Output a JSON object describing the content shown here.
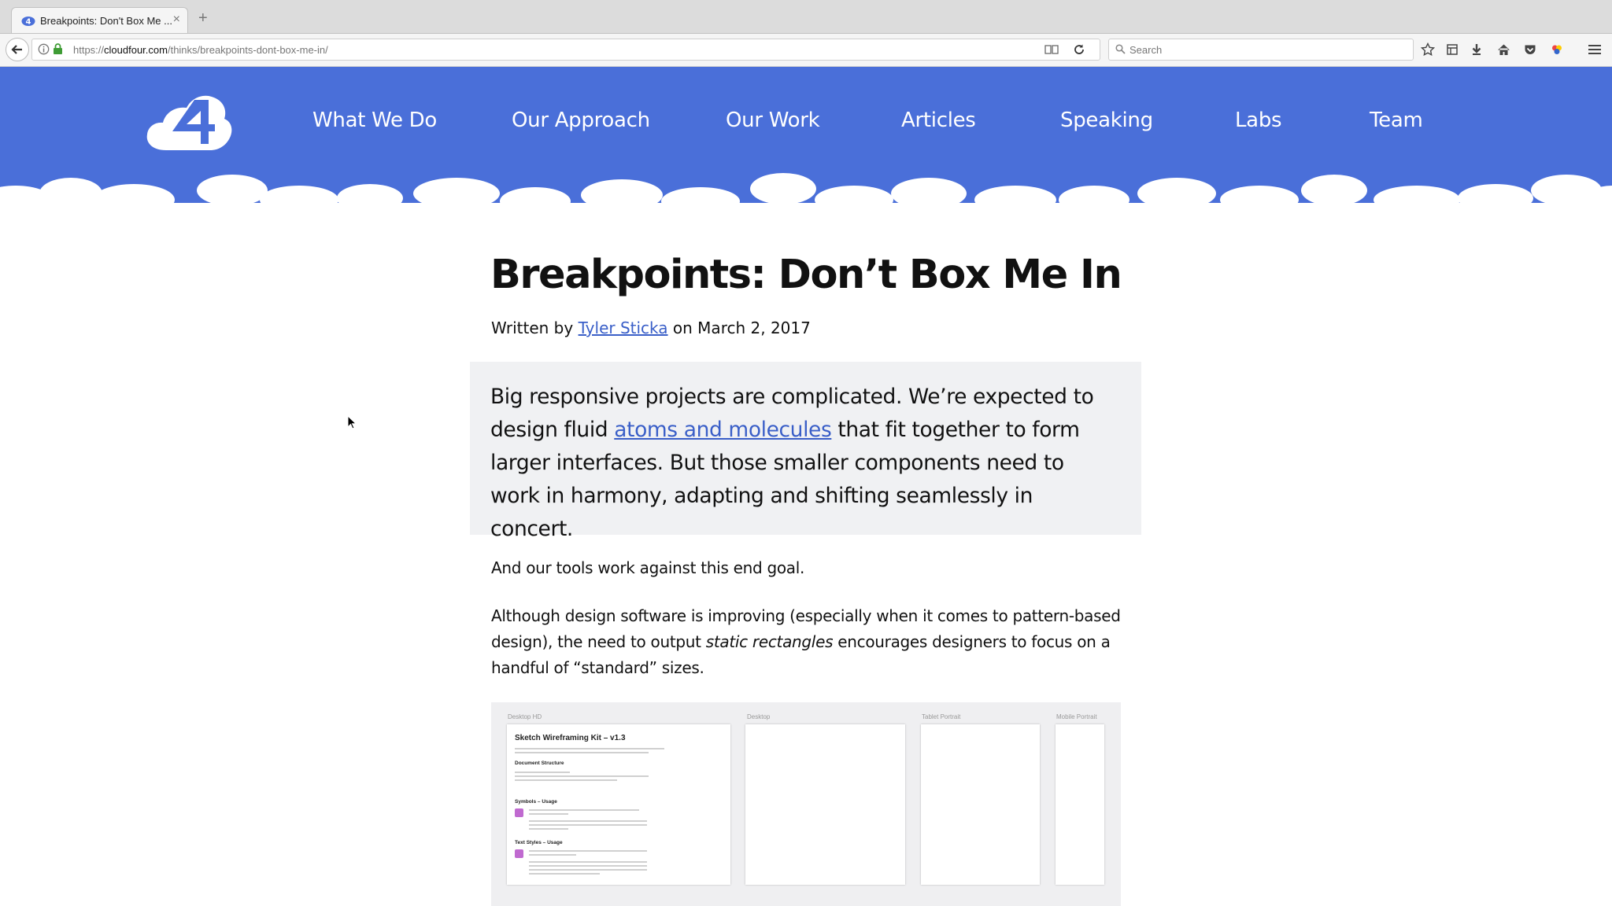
{
  "browser": {
    "tab_title": "Breakpoints: Don't Box Me ...",
    "url_prefix": "https://",
    "url_host": "cloudfour.com",
    "url_path": "/thinks/breakpoints-dont-box-me-in/",
    "search_placeholder": "Search"
  },
  "site": {
    "brand_color": "#4a6fd9",
    "nav": [
      "What We Do",
      "Our Approach",
      "Our Work",
      "Articles",
      "Speaking",
      "Labs",
      "Team"
    ]
  },
  "article": {
    "title": "Breakpoints: Don’t Box Me In",
    "byline_prefix": "Written by",
    "author": "Tyler Sticka",
    "byline_suffix": "on March 2, 2017",
    "intro_before_link": "Big responsive projects are complicated. We’re expected to design fluid",
    "intro_link": "atoms and molecules",
    "intro_after_link": "that fit together to form larger interfaces. But those smaller components need to work in harmony, adapting and shifting seamlessly in concert.",
    "para1": "And our tools work against this end goal.",
    "para2_before": "Although design software is improving (especially when it comes to pattern-based design), the need to output",
    "para2_em": "static rectangles",
    "para2_after": "encourages designers to focus on a handful of “standard” sizes."
  },
  "sketch_image": {
    "artboards": [
      "Desktop HD",
      "Desktop",
      "Tablet Portrait",
      "Mobile Portrait"
    ],
    "kit_title": "Sketch Wireframing Kit – v1.3",
    "sections": [
      "Document Structure",
      "Symbols – Usage",
      "Text Styles – Usage"
    ]
  }
}
